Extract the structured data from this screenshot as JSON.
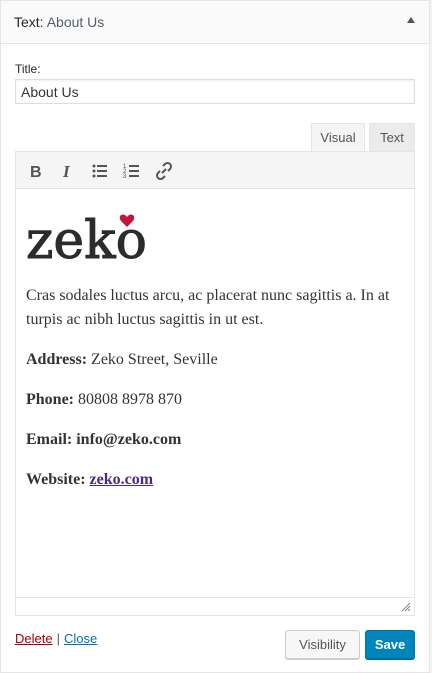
{
  "widget": {
    "title_prefix": "Text:",
    "title_name": "About Us"
  },
  "form": {
    "title_label": "Title:",
    "title_value": "About Us"
  },
  "editor": {
    "tabs": {
      "visual": "Visual",
      "text": "Text"
    },
    "toolbar": [
      "bold-icon",
      "italic-icon",
      "bulleted-list-icon",
      "numbered-list-icon",
      "link-icon"
    ],
    "logo_text": "zeko",
    "paragraph": "Cras sodales luctus arcu, ac placerat nunc sagittis a. In at turpis ac nibh luctus sagittis in ut est.",
    "address": {
      "label": "Address:",
      "value": " Zeko Street, Seville"
    },
    "phone": {
      "label": "Phone:",
      "value": " 80808 8978 870"
    },
    "email": {
      "label": "Email:",
      "value": " info@zeko.com"
    },
    "website": {
      "label": "Website:",
      "link": "zeko.com"
    }
  },
  "actions": {
    "delete": "Delete",
    "separator": "|",
    "close": "Close",
    "visibility": "Visibility",
    "save": "Save"
  },
  "colors": {
    "save_button": "#0085ba",
    "delete_link": "#aa0000",
    "close_link": "#0073aa",
    "logo_heart": "#c4163a"
  }
}
